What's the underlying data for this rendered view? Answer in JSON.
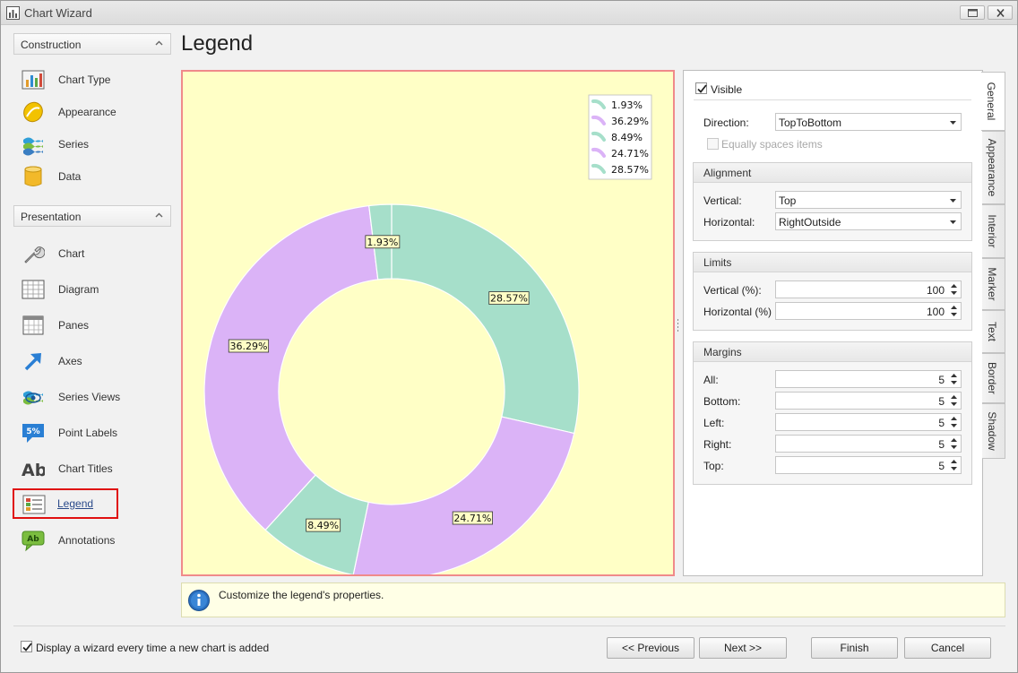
{
  "window": {
    "title": "Chart Wizard"
  },
  "nav": {
    "construction": {
      "header": "Construction",
      "items": [
        {
          "label": "Chart Type",
          "icon": "chart-type-icon"
        },
        {
          "label": "Appearance",
          "icon": "appearance-icon"
        },
        {
          "label": "Series",
          "icon": "series-icon"
        },
        {
          "label": "Data",
          "icon": "data-icon"
        }
      ]
    },
    "presentation": {
      "header": "Presentation",
      "items": [
        {
          "label": "Chart",
          "icon": "wrench-icon"
        },
        {
          "label": "Diagram",
          "icon": "diagram-icon"
        },
        {
          "label": "Panes",
          "icon": "panes-icon"
        },
        {
          "label": "Axes",
          "icon": "axes-arrow-icon"
        },
        {
          "label": "Series Views",
          "icon": "series-views-icon"
        },
        {
          "label": "Point Labels",
          "icon": "point-labels-icon"
        },
        {
          "label": "Chart Titles",
          "icon": "chart-titles-icon"
        },
        {
          "label": "Legend",
          "icon": "legend-icon",
          "selected": true
        },
        {
          "label": "Annotations",
          "icon": "annotations-icon"
        }
      ]
    }
  },
  "page_title": "Legend",
  "chart_data": {
    "type": "pie",
    "style": "doughnut",
    "slices": [
      {
        "label": "28.57%",
        "value": 28.57,
        "color": "#a6dfca"
      },
      {
        "label": "24.71%",
        "value": 24.71,
        "color": "#dbb3f7"
      },
      {
        "label": "8.49%",
        "value": 8.49,
        "color": "#a6dfca"
      },
      {
        "label": "36.29%",
        "value": 36.29,
        "color": "#dbb3f7"
      },
      {
        "label": "1.93%",
        "value": 1.93,
        "color": "#a6dfca"
      }
    ],
    "legend": {
      "placement": "top-right",
      "entries": [
        {
          "label": "1.93%",
          "color": "#a6dfca"
        },
        {
          "label": "36.29%",
          "color": "#dbb3f7"
        },
        {
          "label": "8.49%",
          "color": "#a6dfca"
        },
        {
          "label": "24.71%",
          "color": "#dbb3f7"
        },
        {
          "label": "28.57%",
          "color": "#a6dfca"
        }
      ]
    },
    "background": "#ffffc6"
  },
  "properties": {
    "tabs": [
      "General",
      "Appearance",
      "Interior",
      "Marker",
      "Text",
      "Border",
      "Shadow"
    ],
    "active_tab": "General",
    "visible": {
      "label": "Visible",
      "checked": true
    },
    "direction": {
      "label": "Direction:",
      "value": "TopToBottom"
    },
    "equally_spaces": {
      "label": "Equally spaces items",
      "checked": false,
      "enabled": false
    },
    "alignment": {
      "header": "Alignment",
      "vertical": {
        "label": "Vertical:",
        "value": "Top"
      },
      "horizontal": {
        "label": "Horizontal:",
        "value": "RightOutside"
      }
    },
    "limits": {
      "header": "Limits",
      "vertical": {
        "label": "Vertical (%):",
        "value": "100"
      },
      "horizontal": {
        "label": "Horizontal (%)",
        "value": "100"
      }
    },
    "margins": {
      "header": "Margins",
      "all": {
        "label": "All:",
        "value": "5"
      },
      "bottom": {
        "label": "Bottom:",
        "value": "5"
      },
      "left": {
        "label": "Left:",
        "value": "5"
      },
      "right": {
        "label": "Right:",
        "value": "5"
      },
      "top": {
        "label": "Top:",
        "value": "5"
      }
    }
  },
  "hint": "Customize the legend's properties.",
  "footer": {
    "show_wizard": {
      "label": "Display a wizard every time a new chart is added",
      "checked": true
    },
    "buttons": {
      "previous": "<< Previous",
      "next": "Next >>",
      "finish": "Finish",
      "cancel": "Cancel"
    }
  },
  "colors": {
    "accent_selected": "#e01010",
    "chart_bg": "#ffffc6",
    "chart_border": "#f08a8a"
  }
}
